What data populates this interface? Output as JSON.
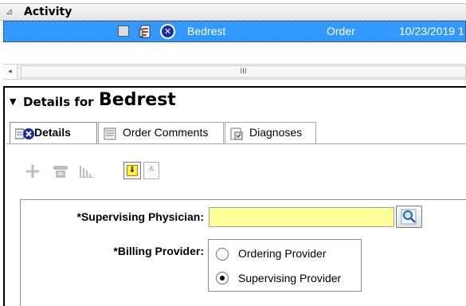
{
  "activity": {
    "title": "Activity",
    "collapse_icon": "triangle-collapse-icon",
    "row": {
      "name": "Bedrest",
      "type": "Order",
      "date": "10/23/2019 1",
      "icons": [
        "checkbox-icon",
        "order-document-icon",
        "cancel-x-icon"
      ]
    },
    "scrollbar": {
      "left_arrow": "◂",
      "thumb_grip": "III"
    }
  },
  "details": {
    "title_prefix": "Details for",
    "title_name": "Bedrest",
    "collapse_icon": "triangle-down-icon",
    "tabs": [
      {
        "label": "Details",
        "icon": "details-cancel-icon"
      },
      {
        "label": "Order Comments",
        "icon": "comments-icon"
      },
      {
        "label": "Diagnoses",
        "icon": "diagnoses-icon"
      }
    ],
    "toolbar": {
      "plus": "+",
      "down_arrow": "⇓",
      "chevrons": "≚"
    },
    "form": {
      "supervising_label": "*Supervising Physician:",
      "supervising_value": "",
      "billing_label": "*Billing Provider:",
      "billing_options": [
        {
          "label": "Ordering Provider",
          "selected": false
        },
        {
          "label": "Supervising Provider",
          "selected": true
        }
      ]
    }
  },
  "colors": {
    "selection": "#3399ff",
    "required_field": "#ffff99",
    "cancel_icon": "#1c2aa6"
  }
}
